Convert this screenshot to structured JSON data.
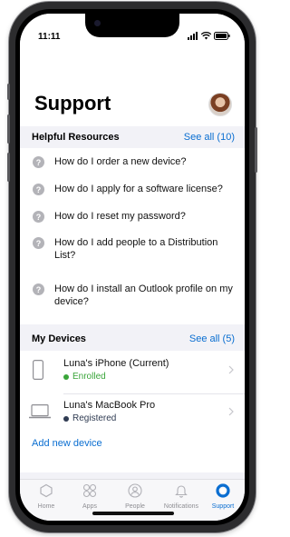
{
  "status_bar": {
    "time": "11:11",
    "signal_icon": "signal-bars-icon",
    "wifi_icon": "wifi-icon",
    "battery_icon": "battery-icon"
  },
  "header": {
    "title": "Support"
  },
  "helpful_resources": {
    "title": "Helpful Resources",
    "see_all": "See all (10)",
    "items": [
      "How do I order a new device?",
      "How do I apply for a software license?",
      "How do I reset my password?",
      "How do I add people to a Distribution List?",
      "How do I install an Outlook profile on my device?"
    ]
  },
  "my_devices": {
    "title": "My Devices",
    "see_all": "See all (5)",
    "devices": [
      {
        "name": "Luna's iPhone (Current)",
        "status": "Enrolled",
        "status_color": "#3aa53a",
        "icon": "phone-icon"
      },
      {
        "name": "Luna's MacBook Pro",
        "status": "Registered",
        "status_color": "#2f3b52",
        "icon": "laptop-icon"
      }
    ],
    "add_label": "Add new device"
  },
  "tabs": [
    {
      "label": "Home",
      "icon": "home-icon",
      "active": false
    },
    {
      "label": "Apps",
      "icon": "apps-grid-icon",
      "active": false
    },
    {
      "label": "People",
      "icon": "people-icon",
      "active": false
    },
    {
      "label": "Notifications",
      "icon": "bell-icon",
      "active": false
    },
    {
      "label": "Support",
      "icon": "support-lifebuoy-icon",
      "active": true
    }
  ],
  "colors": {
    "accent": "#0a6ed1",
    "enrolled": "#3aa53a",
    "registered": "#2f3b52"
  }
}
